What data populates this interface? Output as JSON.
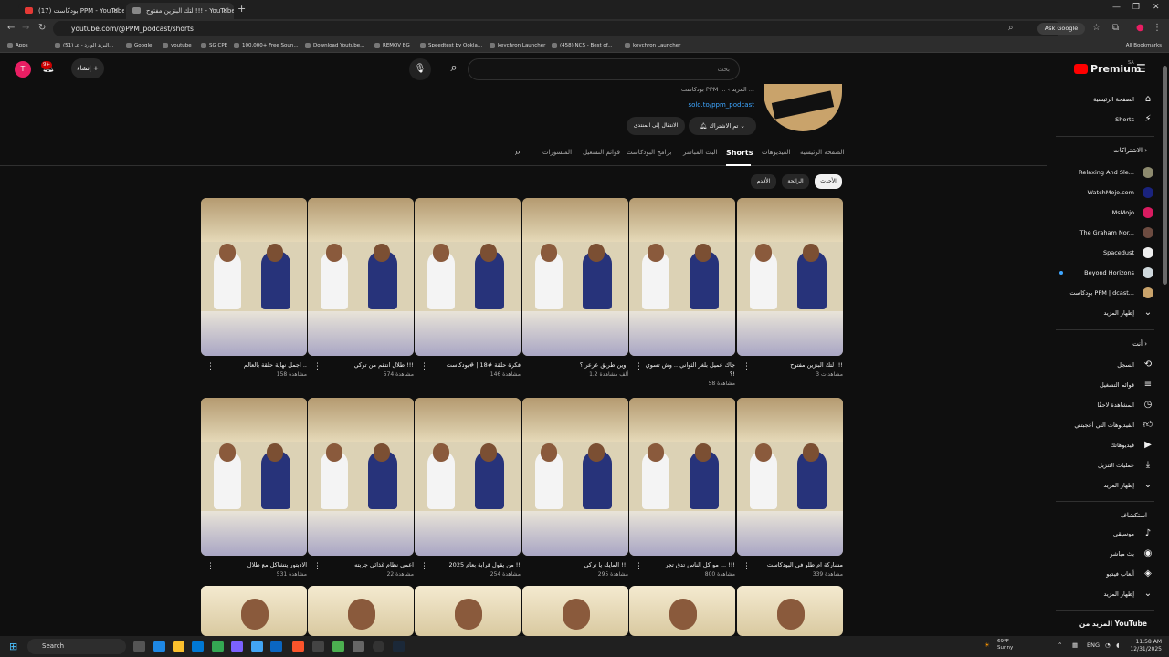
{
  "browser": {
    "tabs": [
      {
        "title": "(17) بودكاست PPM - YouTube",
        "active": false
      },
      {
        "title": "لتك البنزين مفتوح !!! - YouTube",
        "active": true
      }
    ],
    "url": "youtube.com/@PPM_podcast/shorts",
    "ask_google": "Ask Google",
    "bookmarks": [
      "Apps",
      "(51) البريد الوارد - عـ...",
      "Google",
      "youtube",
      "SG CPE",
      "100,000+ Free Soun...",
      "Download Youtube...",
      "REMOV BG",
      "Speedtest by Ookla...",
      "keychron Launcher",
      "(458) NCS - Best of...",
      "keychron Launcher"
    ],
    "all_bookmarks": "All Bookmarks"
  },
  "youtube": {
    "logo": "Premium",
    "logo_sup": "SA",
    "search_placeholder": "بحث",
    "create_label": "إنشاء",
    "notif_count": "9+",
    "avatar_letter": "T"
  },
  "channel": {
    "handle": "بودكاست PPM ... ‹ المزيد ...",
    "link": "solo.to/ppm_podcast",
    "subscribe": "تم الاشتراك",
    "community": "الانتقال إلى المنتدى",
    "tabs": [
      "الصفحة الرئيسية",
      "الفيديوهات",
      "Shorts",
      "البث المباشر",
      "برامج البودكاست",
      "قوائم التشغيل",
      "المنشورات"
    ],
    "active_tab": "Shorts",
    "chips": [
      "الأحدث",
      "الرائجة",
      "الأقدم"
    ]
  },
  "shorts": [
    {
      "title": "لتك البنزين مفتوح !!!",
      "views": "3 مشاهدات"
    },
    {
      "title": "جاك عميل بلغز الثواني .. وش تسوي ؟!",
      "views": "58 مشاهدة"
    },
    {
      "title": "وين طريق عرعر ؟!",
      "views": "1.2 ألف مشاهدة"
    },
    {
      "title": "فكرة حلقة #18 | #بودكاست",
      "views": "146 مشاهدة"
    },
    {
      "title": "طلال انتقم من تركي !!!",
      "views": "574 مشاهدة"
    },
    {
      "title": "اجمل نهاية حلقة بالعالم ..",
      "views": "158 مشاهدة"
    },
    {
      "title": "مشاركة ام طلو في البودكاست",
      "views": "339 مشاهدة"
    },
    {
      "title": "مو كل الناس تدق تجر ... !!!",
      "views": "800 مشاهدة"
    },
    {
      "title": "المايك يا تركي !!!",
      "views": "295 مشاهدة"
    },
    {
      "title": "من يقول قرابة بعام 2025 !!",
      "views": "254 مشاهدة"
    },
    {
      "title": "اعمى نظام غذائي جربته",
      "views": "22 مشاهدة"
    },
    {
      "title": "الادبتور يتشاكل مع طلال",
      "views": "531 مشاهدة"
    }
  ],
  "sidebar": {
    "main": [
      "الصفحة الرئيسية",
      "Shorts"
    ],
    "subs_header": "الاشتراكات",
    "subs": [
      "Relaxing And Sle...",
      "WatchMojo.com",
      "MsMojo",
      "The Graham Nor...",
      "Spacedust",
      "Beyond Horizons",
      "بودكاست PPM | dcast..."
    ],
    "show_more": "إظهار المزيد",
    "you_header": "أنت",
    "you": [
      "السجل",
      "قوائم التشغيل",
      "المشاهدة لاحقًا",
      "الفيديوهات التي أعجبتني",
      "فيديوهاتك",
      "عمليات التنزيل"
    ],
    "explore_header": "استكشاف",
    "explore": [
      "موسيقى",
      "بث مباشر",
      "ألعاب فيديو"
    ],
    "more_from": "المزيد من YouTube"
  },
  "taskbar": {
    "search": "Search",
    "weather_temp": "69°F",
    "weather_desc": "Sunny",
    "lang": "ENG",
    "time": "11:58 AM",
    "date": "12/31/2025"
  },
  "colors": {
    "accent": "#ff0000",
    "link": "#3ea6ff",
    "bg": "#0f0f0f"
  }
}
